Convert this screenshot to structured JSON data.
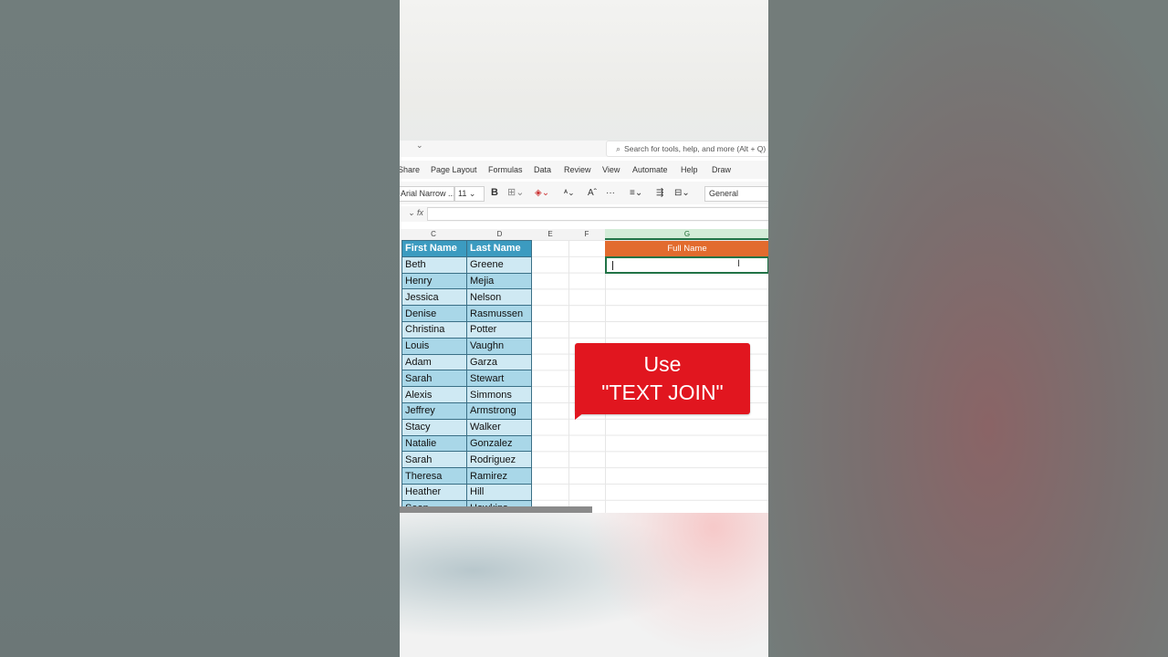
{
  "ribbon": {
    "search_placeholder": "Search for tools, help, and more (Alt + Q)",
    "menu": [
      "Share",
      "Page Layout",
      "Formulas",
      "Data",
      "Review",
      "View",
      "Automate",
      "Help",
      "Draw"
    ],
    "font_name": "Arial Narrow ...",
    "font_size": "11",
    "bold_label": "B",
    "number_format": "General"
  },
  "sheet": {
    "columns": [
      "C",
      "D",
      "E",
      "F",
      "G"
    ],
    "headers": {
      "first": "First Name",
      "last": "Last Name",
      "full": "Full Name"
    },
    "rows": [
      [
        "Beth",
        "Greene"
      ],
      [
        "Henry",
        "Mejia"
      ],
      [
        "Jessica",
        "Nelson"
      ],
      [
        "Denise",
        "Rasmussen"
      ],
      [
        "Christina",
        "Potter"
      ],
      [
        "Louis",
        "Vaughn"
      ],
      [
        "Adam",
        "Garza"
      ],
      [
        "Sarah",
        "Stewart"
      ],
      [
        "Alexis",
        "Simmons"
      ],
      [
        "Jeffrey",
        "Armstrong"
      ],
      [
        "Stacy",
        "Walker"
      ],
      [
        "Natalie",
        "Gonzalez"
      ],
      [
        "Sarah",
        "Rodriguez"
      ],
      [
        "Theresa",
        "Ramirez"
      ],
      [
        "Heather",
        "Hill"
      ],
      [
        "Sean",
        "Hawkins"
      ]
    ]
  },
  "callout": {
    "line1": "Use",
    "line2": "\"TEXT JOIN\"",
    "color": "#e1161f"
  },
  "colors": {
    "header_blue": "#3c9bc0",
    "full_name_orange": "#e26b2e",
    "excel_green": "#217346"
  }
}
